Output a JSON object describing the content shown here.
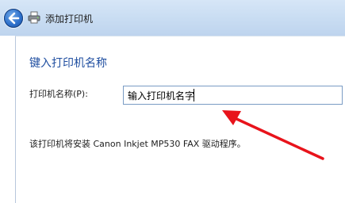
{
  "window": {
    "title": "添加打印机",
    "back_icon": "back-arrow-icon",
    "app_icon": "printer-icon"
  },
  "main": {
    "heading": "键入打印机名称",
    "name_label": "打印机名称(P):",
    "name_value": "输入打印机名字",
    "driver_info": "该打印机将安装 Canon Inkjet MP530 FAX 驱动程序。"
  },
  "annotation": {
    "arrow_color": "#e8131b"
  },
  "colors": {
    "heading": "#1f4ea0",
    "header_bg": "#c8dcf2",
    "input_border": "#7a9cc4"
  }
}
